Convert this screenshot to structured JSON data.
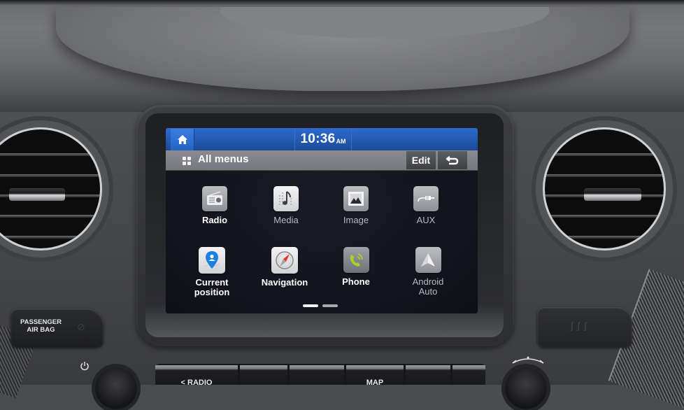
{
  "status_bar": {
    "home_icon": "home-icon",
    "time": "10:36",
    "ampm": "AM"
  },
  "title_bar": {
    "icon": "grid-icon",
    "title": "All menus",
    "edit_label": "Edit",
    "back_icon": "back-arrow-icon"
  },
  "menu_items": [
    {
      "label": "Radio",
      "icon": "radio-icon",
      "active": true
    },
    {
      "label": "Media",
      "icon": "music-note-icon",
      "active": false
    },
    {
      "label": "Image",
      "icon": "image-icon",
      "active": false
    },
    {
      "label": "AUX",
      "icon": "aux-cable-icon",
      "active": false
    },
    {
      "label": "Current",
      "label2": "position",
      "icon": "location-pin-icon",
      "active": true
    },
    {
      "label": "Navigation",
      "icon": "compass-icon",
      "active": true
    },
    {
      "label": "Phone",
      "icon": "phone-icon",
      "active": true
    },
    {
      "label": "Android",
      "label2": "Auto",
      "icon": "android-auto-icon",
      "active": false
    }
  ],
  "pager": {
    "pages": 2,
    "current": 1
  },
  "dashboard": {
    "airbag_line1": "PASSENGER",
    "airbag_line2": "AIR BAG",
    "strip_buttons": [
      "< RADIO",
      "",
      "",
      "MAP",
      "",
      ""
    ]
  },
  "colors": {
    "status_blue": "#2d6bcf",
    "title_gray": "#8a8b90",
    "screen_bg": "#12131c",
    "phone_green": "#a6d22c",
    "nav_red": "#e8342c",
    "pin_blue": "#1e7fe0"
  }
}
